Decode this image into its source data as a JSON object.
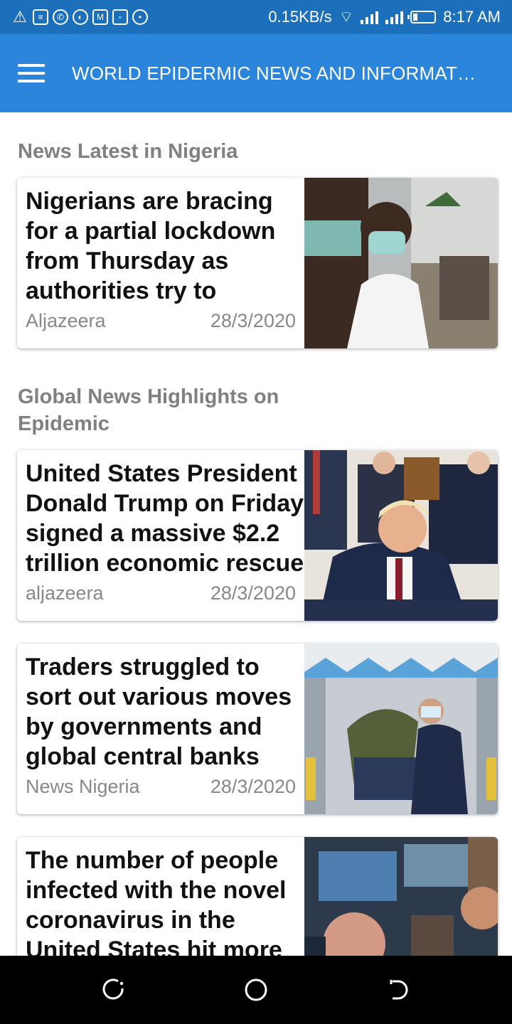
{
  "status_bar": {
    "network_speed": "0.15KB/s",
    "time": "8:17 AM",
    "icons": [
      "warning-icon",
      "message-icon",
      "whatsapp-icon",
      "app-icon",
      "mail-icon",
      "gallery-icon",
      "sync-icon",
      "hotspot-icon",
      "signal-icon",
      "signal-icon",
      "battery-icon"
    ]
  },
  "app_bar": {
    "title": "WORLD EPIDERMIC NEWS AND INFORMATI…",
    "menu_icon": "hamburger-menu-icon"
  },
  "sections": [
    {
      "title": "News Latest in Nigeria",
      "cards": [
        {
          "headline": "Nigerians are bracing for a partial lockdown from Thursday as authorities try to",
          "source": "Aljazeera",
          "date": "28/3/2020",
          "image": "people-wearing-masks-photo"
        }
      ]
    },
    {
      "title": "Global News Highlights on Epidemic",
      "cards": [
        {
          "headline": "United States President Donald Trump on Friday signed a massive $2.2 trillion economic rescue",
          "source": "aljazeera",
          "date": "28/3/2020",
          "image": "president-signing-bill-photo"
        },
        {
          "headline": "Traders struggled to sort out various moves by governments and global central banks",
          "source": "News Nigeria",
          "date": "28/3/2020",
          "image": "paramedics-ambulance-photo"
        },
        {
          "headline": "The number of people infected with the novel coronavirus in the United States hit more",
          "source": "",
          "date": "",
          "image": "stock-traders-photo"
        }
      ]
    }
  ],
  "nav_bar": {
    "icons": [
      "recents-icon",
      "home-icon",
      "back-icon"
    ]
  }
}
